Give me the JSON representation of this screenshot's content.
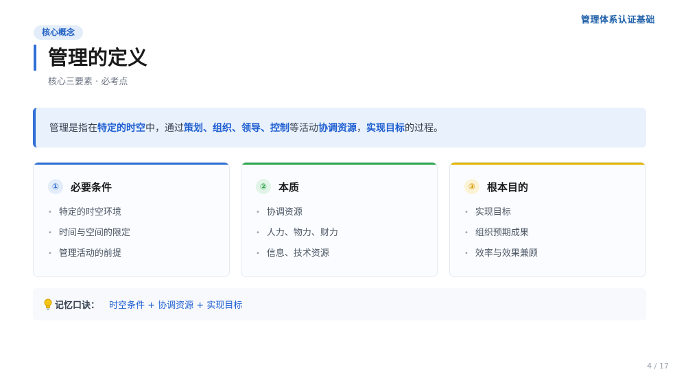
{
  "header": {
    "brand": "管理体系认证基础"
  },
  "tag": "核心概念",
  "title": "管理的定义",
  "subtitle": "核心三要素 · 必考点",
  "definition": {
    "parts": [
      "管理是指在",
      "特定的时空",
      "中，通过",
      "策划、组织、领导、控制",
      "等活动",
      "协调资源",
      "，",
      "实现目标",
      "的过程。"
    ]
  },
  "cards": [
    {
      "num": "①",
      "title": "必要条件",
      "accent": "#2f6fd6",
      "items": [
        "特定的时空环境",
        "时间与空间的限定",
        "管理活动的前提"
      ]
    },
    {
      "num": "②",
      "title": "本质",
      "accent": "#2fa84f",
      "items": [
        "协调资源",
        "人力、物力、财力",
        "信息、技术资源"
      ]
    },
    {
      "num": "③",
      "title": "根本目的",
      "accent": "#e5a400",
      "items": [
        "实现目标",
        "组织预期成果",
        "效率与效果兼顾"
      ]
    }
  ],
  "memory": {
    "label": "记忆口诀：",
    "text": "时空条件 + 协调资源 + 实现目标"
  },
  "page": "4 / 17"
}
